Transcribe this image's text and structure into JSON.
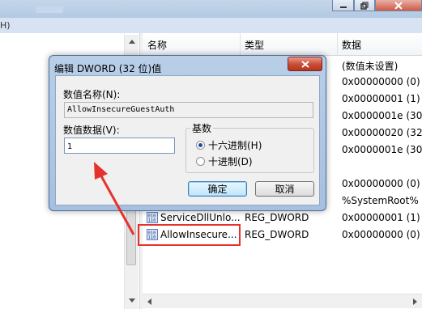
{
  "window": {
    "menu_fragment": "H)"
  },
  "list": {
    "headers": {
      "name": "名称",
      "type": "类型",
      "data": "数据"
    },
    "rows": [
      {
        "name": "",
        "type": "",
        "data": "(数值未设置)"
      },
      {
        "name": "",
        "type": "",
        "data": "0x00000000 (0)"
      },
      {
        "name": "",
        "type": "",
        "data": "0x00000001 (1)"
      },
      {
        "name": "",
        "type": "",
        "data": "0x0000001e (30)"
      },
      {
        "name": "",
        "type": "",
        "data": "0x00000020 (32)"
      },
      {
        "name": "",
        "type": "",
        "data": "0x0000001e (30)"
      },
      {
        "name": "",
        "type": "",
        "data": ""
      },
      {
        "name": "",
        "type": "",
        "data": "0x00000000 (0)"
      },
      {
        "name": "",
        "type": "",
        "data": "%SystemRoot%"
      },
      {
        "name": "ServiceDllUnlo...",
        "type": "REG_DWORD",
        "data": "0x00000001 (1)"
      },
      {
        "name": "AllowInsecure...",
        "type": "REG_DWORD",
        "data": "0x00000000 (0)"
      }
    ]
  },
  "dialog": {
    "title": "编辑 DWORD (32 位)值",
    "value_name_label": "数值名称(N):",
    "value_name": "AllowInsecureGuestAuth",
    "value_data_label": "数值数据(V):",
    "value_data": "1",
    "base_label": "基数",
    "radio_hex": "十六进制(H)",
    "radio_dec": "十进制(D)",
    "selected_base": "hex",
    "ok_label": "确定",
    "cancel_label": "取消"
  },
  "colors": {
    "highlight": "#e5322d",
    "arrow": "#e5322d",
    "close_button": "#c94a33"
  },
  "icons": {
    "close": "close-icon",
    "registry_value": "reg-dword-icon"
  }
}
